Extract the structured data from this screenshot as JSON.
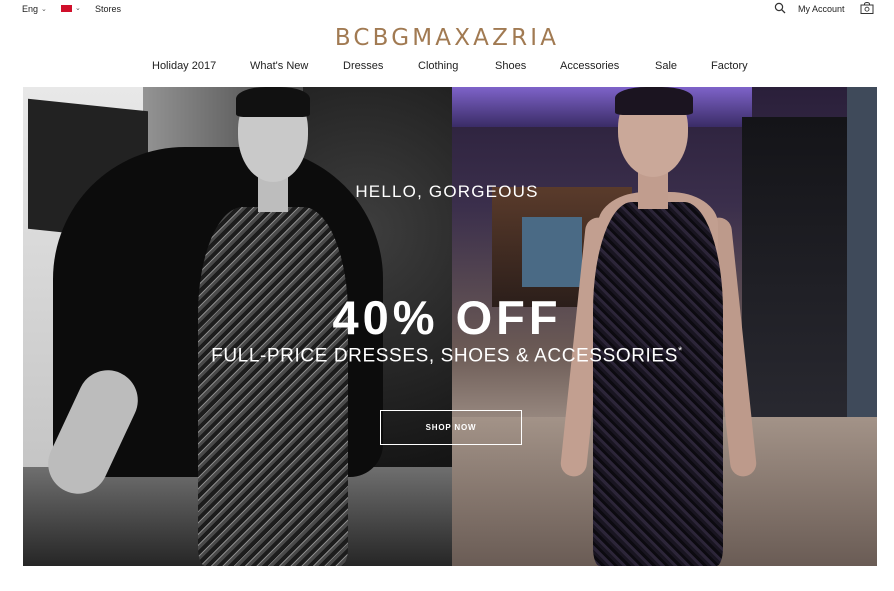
{
  "topbar": {
    "language": "Eng",
    "stores": "Stores",
    "my_account": "My Account"
  },
  "brand": {
    "logo": "BCBGMAXAZRIA",
    "logo_color": "#a17a52"
  },
  "nav": {
    "items": [
      {
        "label": "Holiday 2017"
      },
      {
        "label": "What's New"
      },
      {
        "label": "Dresses"
      },
      {
        "label": "Clothing"
      },
      {
        "label": "Shoes"
      },
      {
        "label": "Accessories"
      },
      {
        "label": "Sale"
      },
      {
        "label": "Factory"
      }
    ]
  },
  "hero": {
    "greeting": "HELLO, GORGEOUS",
    "headline": "40% OFF",
    "subline": "FULL-PRICE DRESSES, SHOES & ACCESSORIES",
    "subline_mark": "*",
    "cta": "SHOP NOW"
  },
  "icons": {
    "search": "search-icon",
    "bag": "shopping-bag-icon",
    "flag": "flag-icon",
    "caret": "chevron-down-icon"
  }
}
